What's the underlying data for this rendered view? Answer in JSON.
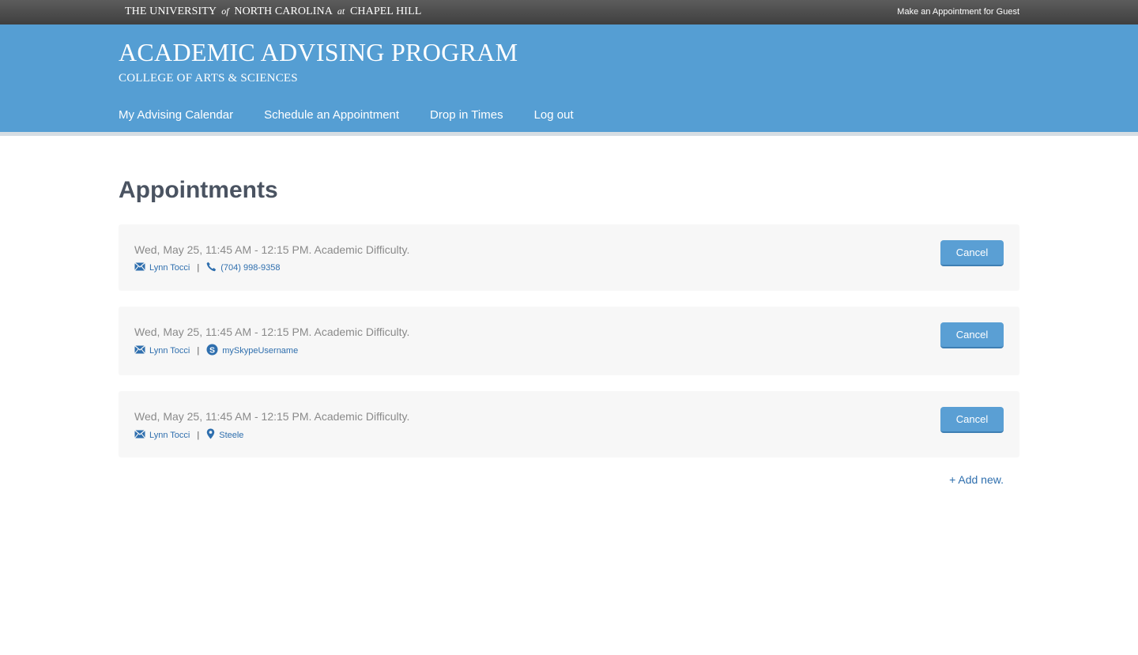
{
  "topbar": {
    "university_pre": "THE UNIVERSITY",
    "university_of": "of",
    "university_mid": "NORTH CAROLINA",
    "university_at": "at",
    "university_post": "CHAPEL HILL",
    "guest_link": "Make an Appointment for Guest"
  },
  "header": {
    "title": "ACADEMIC ADVISING PROGRAM",
    "subtitle": "COLLEGE OF ARTS & SCIENCES",
    "nav": [
      {
        "label": "My Advising Calendar"
      },
      {
        "label": "Schedule an Appointment"
      },
      {
        "label": "Drop in Times"
      },
      {
        "label": "Log out"
      }
    ]
  },
  "main": {
    "page_title": "Appointments",
    "appointments": [
      {
        "when": "Wed, May 25, 11:45 AM - 12:15 PM. Academic Difficulty.",
        "advisor": "Lynn Tocci",
        "contact_icon": "phone-icon",
        "contact": "(704) 998-9358",
        "cancel_label": "Cancel"
      },
      {
        "when": "Wed, May 25, 11:45 AM - 12:15 PM. Academic Difficulty.",
        "advisor": "Lynn Tocci",
        "contact_icon": "skype-icon",
        "contact": "mySkypeUsername",
        "cancel_label": "Cancel"
      },
      {
        "when": "Wed, May 25, 11:45 AM - 12:15 PM. Academic Difficulty.",
        "advisor": "Lynn Tocci",
        "contact_icon": "map-pin-icon",
        "contact": "Steele",
        "cancel_label": "Cancel"
      }
    ],
    "separator": "|",
    "add_new": "+ Add new."
  },
  "colors": {
    "header_blue": "#559ed3",
    "link_blue": "#2f6fae",
    "button_blue": "#5a9fd4",
    "topbar_dark": "#4a4a4a"
  }
}
